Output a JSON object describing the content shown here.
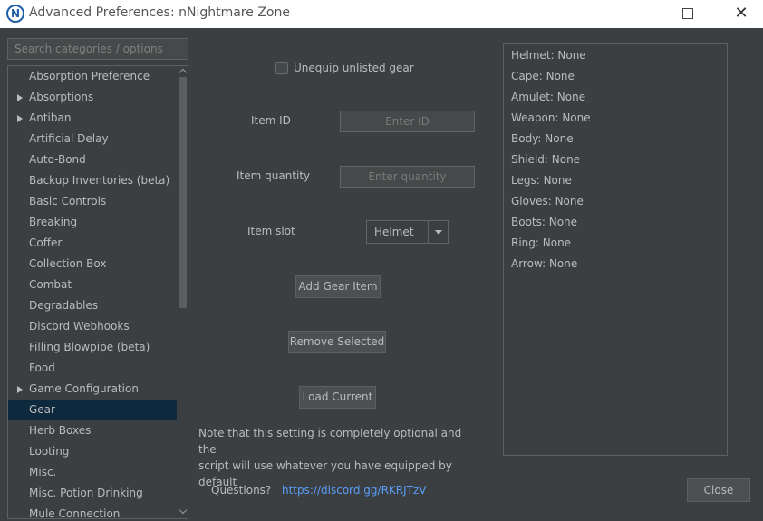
{
  "window": {
    "logo_letter": "N",
    "title": "Advanced Preferences: nNightmare Zone",
    "close_glyph": "✕"
  },
  "search": {
    "placeholder": "Search categories / options"
  },
  "categories": [
    {
      "label": "Absorption Preference",
      "expandable": false
    },
    {
      "label": "Absorptions",
      "expandable": true
    },
    {
      "label": "Antiban",
      "expandable": true
    },
    {
      "label": "Artificial Delay",
      "expandable": false
    },
    {
      "label": "Auto-Bond",
      "expandable": false
    },
    {
      "label": "Backup Inventories (beta)",
      "expandable": false
    },
    {
      "label": "Basic Controls",
      "expandable": false
    },
    {
      "label": "Breaking",
      "expandable": false
    },
    {
      "label": "Coffer",
      "expandable": false
    },
    {
      "label": "Collection Box",
      "expandable": false
    },
    {
      "label": "Combat",
      "expandable": false
    },
    {
      "label": "Degradables",
      "expandable": false
    },
    {
      "label": "Discord Webhooks",
      "expandable": false
    },
    {
      "label": "Filling Blowpipe (beta)",
      "expandable": false
    },
    {
      "label": "Food",
      "expandable": false
    },
    {
      "label": "Game Configuration",
      "expandable": true
    },
    {
      "label": "Gear",
      "expandable": false,
      "selected": true
    },
    {
      "label": "Herb Boxes",
      "expandable": false
    },
    {
      "label": "Looting",
      "expandable": false
    },
    {
      "label": "Misc.",
      "expandable": false
    },
    {
      "label": "Misc. Potion Drinking",
      "expandable": false
    },
    {
      "label": "Mule Connection",
      "expandable": false
    }
  ],
  "form": {
    "unequip_label": "Unequip unlisted gear",
    "item_id_label": "Item ID",
    "item_id_placeholder": "Enter ID",
    "item_quantity_label": "Item quantity",
    "item_quantity_placeholder": "Enter quantity",
    "item_slot_label": "Item slot",
    "item_slot_value": "Helmet",
    "add_button": "Add Gear Item",
    "remove_button": "Remove Selected",
    "load_button": "Load Current",
    "note_line1": "Note that this setting is completely optional and the",
    "note_line2": "script will use whatever you have equipped by default"
  },
  "gear": [
    "Helmet: None",
    "Cape: None",
    "Amulet: None",
    "Weapon: None",
    "Body: None",
    "Shield: None",
    "Legs: None",
    "Gloves: None",
    "Boots: None",
    "Ring: None",
    "Arrow: None"
  ],
  "footer": {
    "questions": "Questions?",
    "link": "https://discord.gg/RKRJTzV",
    "close_button": "Close"
  },
  "colors": {
    "background": "#3c3f41",
    "selection": "#0d293e",
    "link": "#589df6",
    "text": "#bbbbbb"
  }
}
